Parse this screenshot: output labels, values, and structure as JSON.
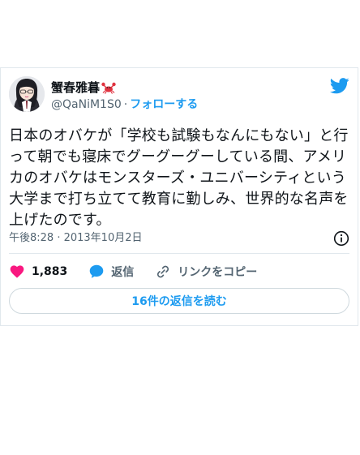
{
  "tweet": {
    "author": {
      "display_name": "蟹春雅暮",
      "handle": "@QaNiM1S0",
      "separator": "·",
      "follow_label": "フォローする",
      "name_emoji_icon": "crab-icon",
      "avatar_icon": "avatar-illustration"
    },
    "brand_icon": "twitter-bird-icon",
    "text": "日本のオバケが「学校も試験もなんにもない」と行って朝でも寝床でグーグーグーしている間、アメリカのオバケはモンスターズ・ユニバーシティという大学まで打ち立てて教育に勤しみ、世界的な名声を上げたのです。",
    "timestamp": "午後8:28 · 2013年10月2日",
    "info_icon": "info-icon",
    "actions": {
      "like_count": "1,883",
      "reply_label": "返信",
      "copy_link_label": "リンクをコピー"
    },
    "read_replies_label": "16件の返信を読む"
  },
  "colors": {
    "accent": "#1d9bf0",
    "like": "#f91880",
    "text": "#0f1419",
    "secondary": "#536471",
    "border": "#e1e8ed"
  }
}
